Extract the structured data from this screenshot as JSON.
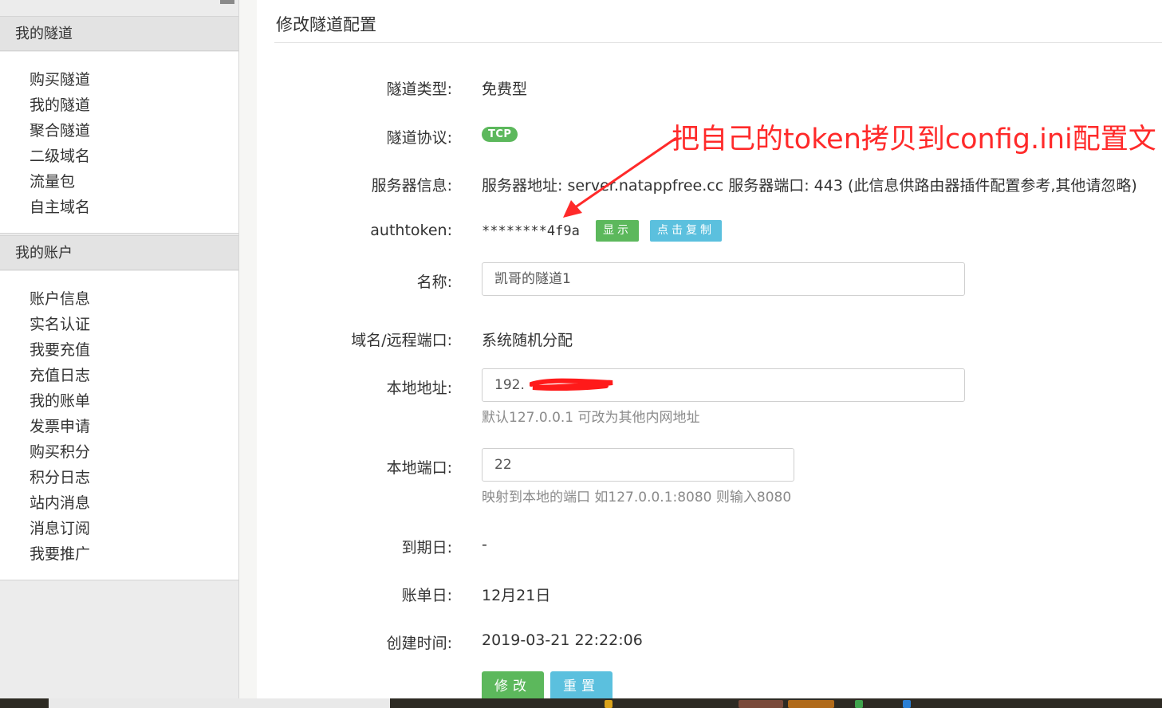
{
  "sidebar": {
    "groups": [
      {
        "title": "我的隧道",
        "items": [
          "购买隧道",
          "我的隧道",
          "聚合隧道",
          "二级域名",
          "流量包",
          "自主域名"
        ]
      },
      {
        "title": "我的账户",
        "items": [
          "账户信息",
          "实名认证",
          "我要充值",
          "充值日志",
          "我的账单",
          "发票申请",
          "购买积分",
          "积分日志",
          "站内消息",
          "消息订阅",
          "我要推广"
        ]
      }
    ]
  },
  "page": {
    "title": "修改隧道配置"
  },
  "form": {
    "tunnel_type": {
      "label": "隧道类型:",
      "value": "免费型"
    },
    "protocol": {
      "label": "隧道协议:",
      "badge": "TCP"
    },
    "server": {
      "label": "服务器信息:",
      "value": "服务器地址: server.natappfree.cc 服务器端口: 443 (此信息供路由器插件配置参考,其他请忽略)"
    },
    "authtoken": {
      "label": "authtoken:",
      "value": "********4f9a",
      "show_button": "显示",
      "copy_button": "点击复制"
    },
    "name": {
      "label": "名称:",
      "value": "凯哥的隧道1"
    },
    "remote_port": {
      "label": "域名/远程端口:",
      "value": "系统随机分配"
    },
    "local_address": {
      "label": "本地地址:",
      "value": "192.",
      "help": "默认127.0.0.1 可改为其他内网地址"
    },
    "local_port": {
      "label": "本地端口:",
      "value": "22",
      "help": "映射到本地的端口 如127.0.0.1:8080 则输入8080"
    },
    "expiry": {
      "label": "到期日:",
      "value": "-"
    },
    "billing_day": {
      "label": "账单日:",
      "value": "12月21日"
    },
    "created": {
      "label": "创建时间:",
      "value": "2019-03-21 22:22:06"
    },
    "submit_button": "修改",
    "reset_button": "重置"
  },
  "annotation": {
    "text": "把自己的token拷贝到config.ini配置文",
    "color": "#ff2a2a"
  },
  "colors": {
    "success": "#5cb85c",
    "info": "#5bc0de",
    "sidebar_bg": "#ececec"
  }
}
